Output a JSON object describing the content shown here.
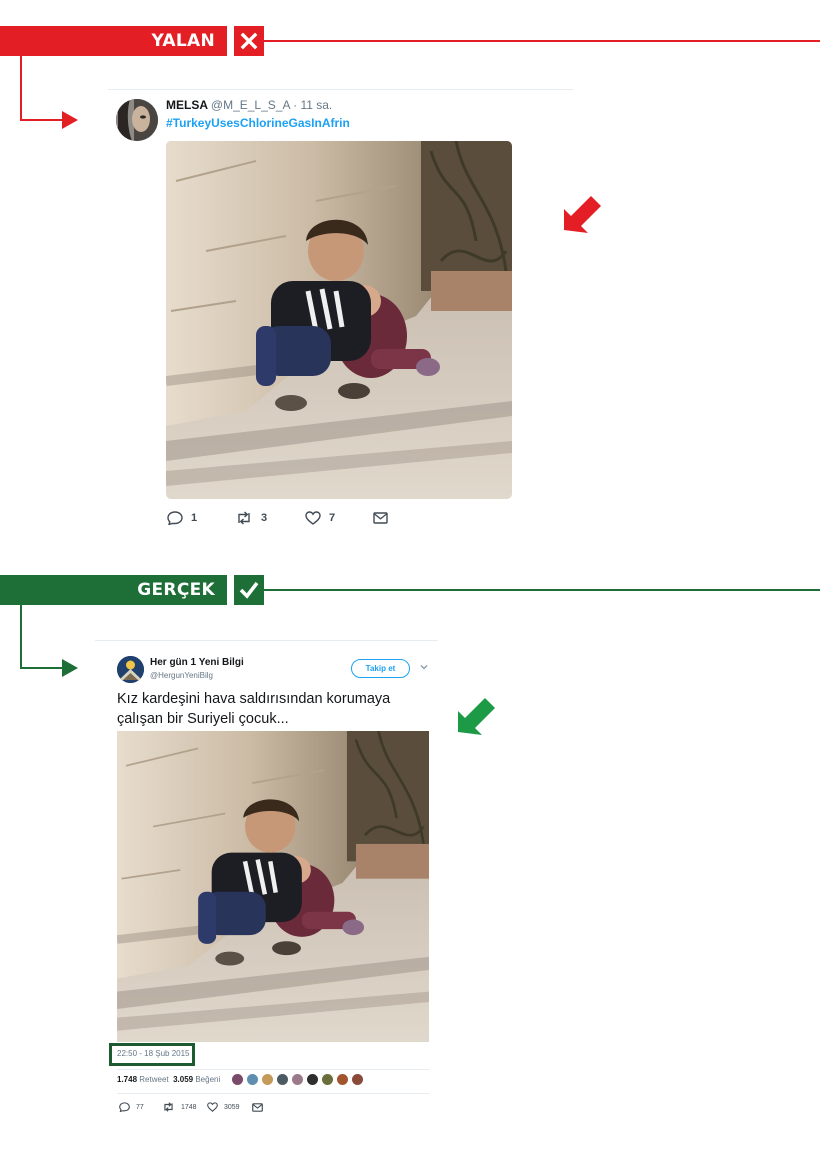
{
  "false_section": {
    "label": "YALAN",
    "icon": "x-mark-icon",
    "color": "#e31e24"
  },
  "false_tweet": {
    "avatar_icon": "profile-photo-avatar",
    "display_name": "MELSA",
    "handle_time": "@M_E_L_S_A · 11 sa.",
    "hashtag": "#TurkeyUsesChlorineGasInAfrin",
    "photo_subject": "Boy shielding younger sister against a stone wall",
    "actions": {
      "reply_count": "1",
      "retweet_count": "3",
      "like_count": "7"
    }
  },
  "true_section": {
    "label": "GERÇEK",
    "icon": "checkmark-icon",
    "color": "#1d6e37"
  },
  "true_tweet": {
    "avatar_icon": "logo-avatar",
    "display_name": "Her gün 1 Yeni Bilgi",
    "handle": "@HergunYeniBilg",
    "follow_label": "Takip et",
    "text": "Kız kardeşini hava saldırısından korumaya çalışan bir Suriyeli çocuk...",
    "timestamp": "22:50 - 18 Şub 2015",
    "retweets_value": "1.748",
    "retweets_label": "Retweet",
    "likes_value": "3.059",
    "likes_label": "Beğeni",
    "actions": {
      "reply_count": "77",
      "retweet_count": "1748",
      "like_count": "3059"
    }
  }
}
